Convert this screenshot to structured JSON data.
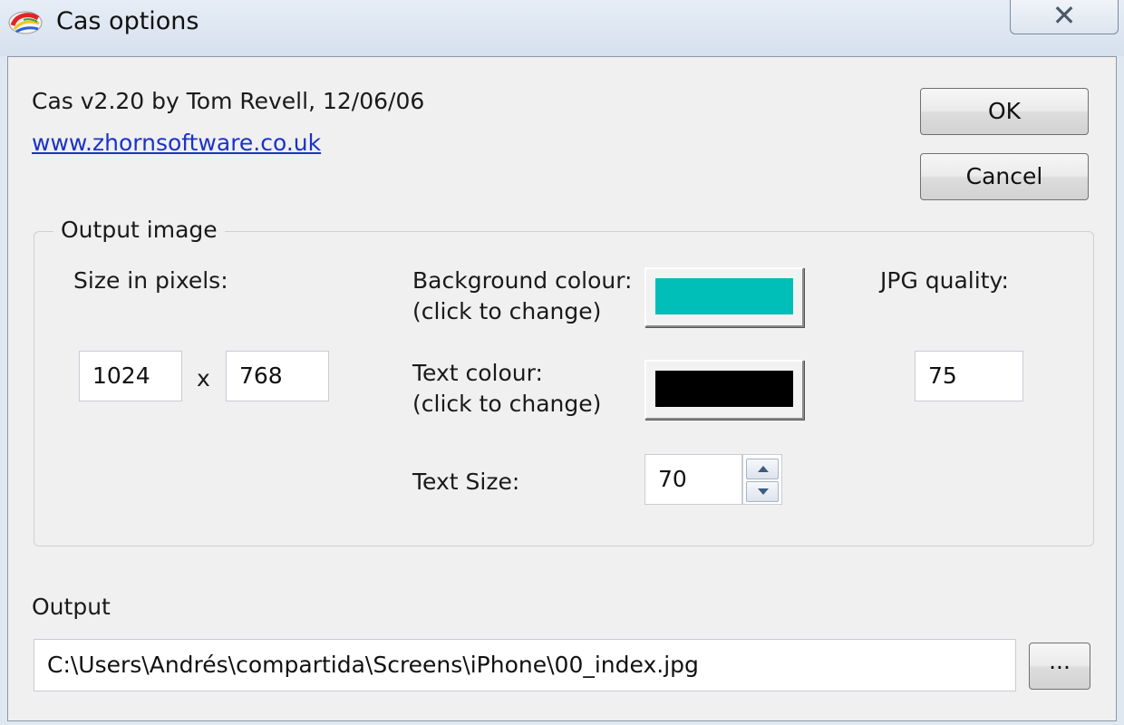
{
  "window": {
    "title": "Cas options",
    "close_glyph": "✕"
  },
  "about": {
    "version_text": "Cas v2.20 by Tom Revell, 12/06/06",
    "website": "www.zhornsoftware.co.uk"
  },
  "buttons": {
    "ok": "OK",
    "cancel": "Cancel",
    "browse": "..."
  },
  "output_image": {
    "group_label": "Output image",
    "size_label": "Size in pixels:",
    "width": "1024",
    "separator": "x",
    "height": "768",
    "background_colour_label": "Background colour:",
    "background_colour_hint": "(click to change)",
    "background_colour": "#00BEB8",
    "text_colour_label": "Text colour:",
    "text_colour_hint": "(click to change)",
    "text_colour": "#000000",
    "text_size_label": "Text Size:",
    "text_size": "70",
    "jpg_quality_label": "JPG quality:",
    "jpg_quality": "75"
  },
  "output": {
    "label": "Output",
    "path": "C:\\Users\\Andrés\\compartida\\Screens\\iPhone\\00_index.jpg"
  },
  "icons": {
    "app": "paint-palette-icon",
    "close": "close-icon",
    "spin_up": "chevron-up-icon",
    "spin_down": "chevron-down-icon"
  }
}
